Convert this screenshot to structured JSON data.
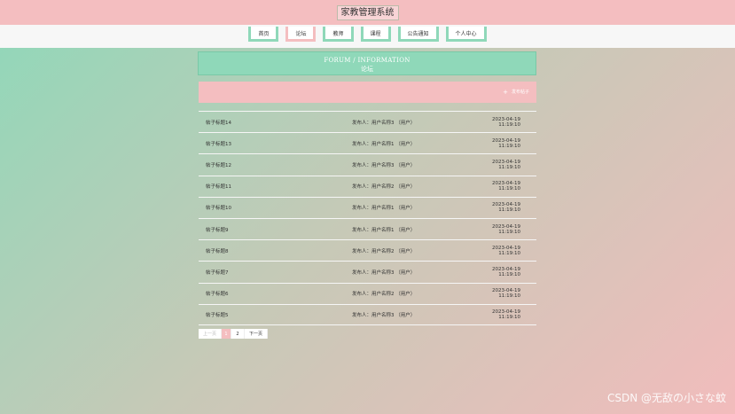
{
  "header": {
    "title": "家教管理系统"
  },
  "nav": [
    {
      "label": "首页",
      "active": false
    },
    {
      "label": "论坛",
      "active": true
    },
    {
      "label": "教师",
      "active": false
    },
    {
      "label": "课程",
      "active": false
    },
    {
      "label": "公告通知",
      "active": false
    },
    {
      "label": "个人中心",
      "active": false
    }
  ],
  "banner": {
    "en": "FORUM / INFORMATION",
    "cn": "论坛"
  },
  "actions": {
    "post_label": "发布帖子",
    "post_icon": "plus-icon"
  },
  "posts": [
    {
      "title": "帖子标题14",
      "author": "发布人：用户名称3 （用户）",
      "date": "2023-04-19 11:19:10"
    },
    {
      "title": "帖子标题13",
      "author": "发布人：用户名称1 （用户）",
      "date": "2023-04-19 11:19:10"
    },
    {
      "title": "帖子标题12",
      "author": "发布人：用户名称3 （用户）",
      "date": "2023-04-19 11:19:10"
    },
    {
      "title": "帖子标题11",
      "author": "发布人：用户名称2 （用户）",
      "date": "2023-04-19 11:19:10"
    },
    {
      "title": "帖子标题10",
      "author": "发布人：用户名称1 （用户）",
      "date": "2023-04-19 11:19:10"
    },
    {
      "title": "帖子标题9",
      "author": "发布人：用户名称1 （用户）",
      "date": "2023-04-19 11:19:10"
    },
    {
      "title": "帖子标题8",
      "author": "发布人：用户名称2 （用户）",
      "date": "2023-04-19 11:19:10"
    },
    {
      "title": "帖子标题7",
      "author": "发布人：用户名称3 （用户）",
      "date": "2023-04-19 11:19:10"
    },
    {
      "title": "帖子标题6",
      "author": "发布人：用户名称2 （用户）",
      "date": "2023-04-19 11:19:10"
    },
    {
      "title": "帖子标题5",
      "author": "发布人：用户名称3 （用户）",
      "date": "2023-04-19 11:19:10"
    }
  ],
  "pagination": {
    "prev": "上一页",
    "pages": [
      "1",
      "2"
    ],
    "current": "1",
    "next": "下一页"
  },
  "watermark": "CSDN @无敌の小さな蚊",
  "colors": {
    "mint": "#8fd8b9",
    "pink": "#f4bec0"
  }
}
